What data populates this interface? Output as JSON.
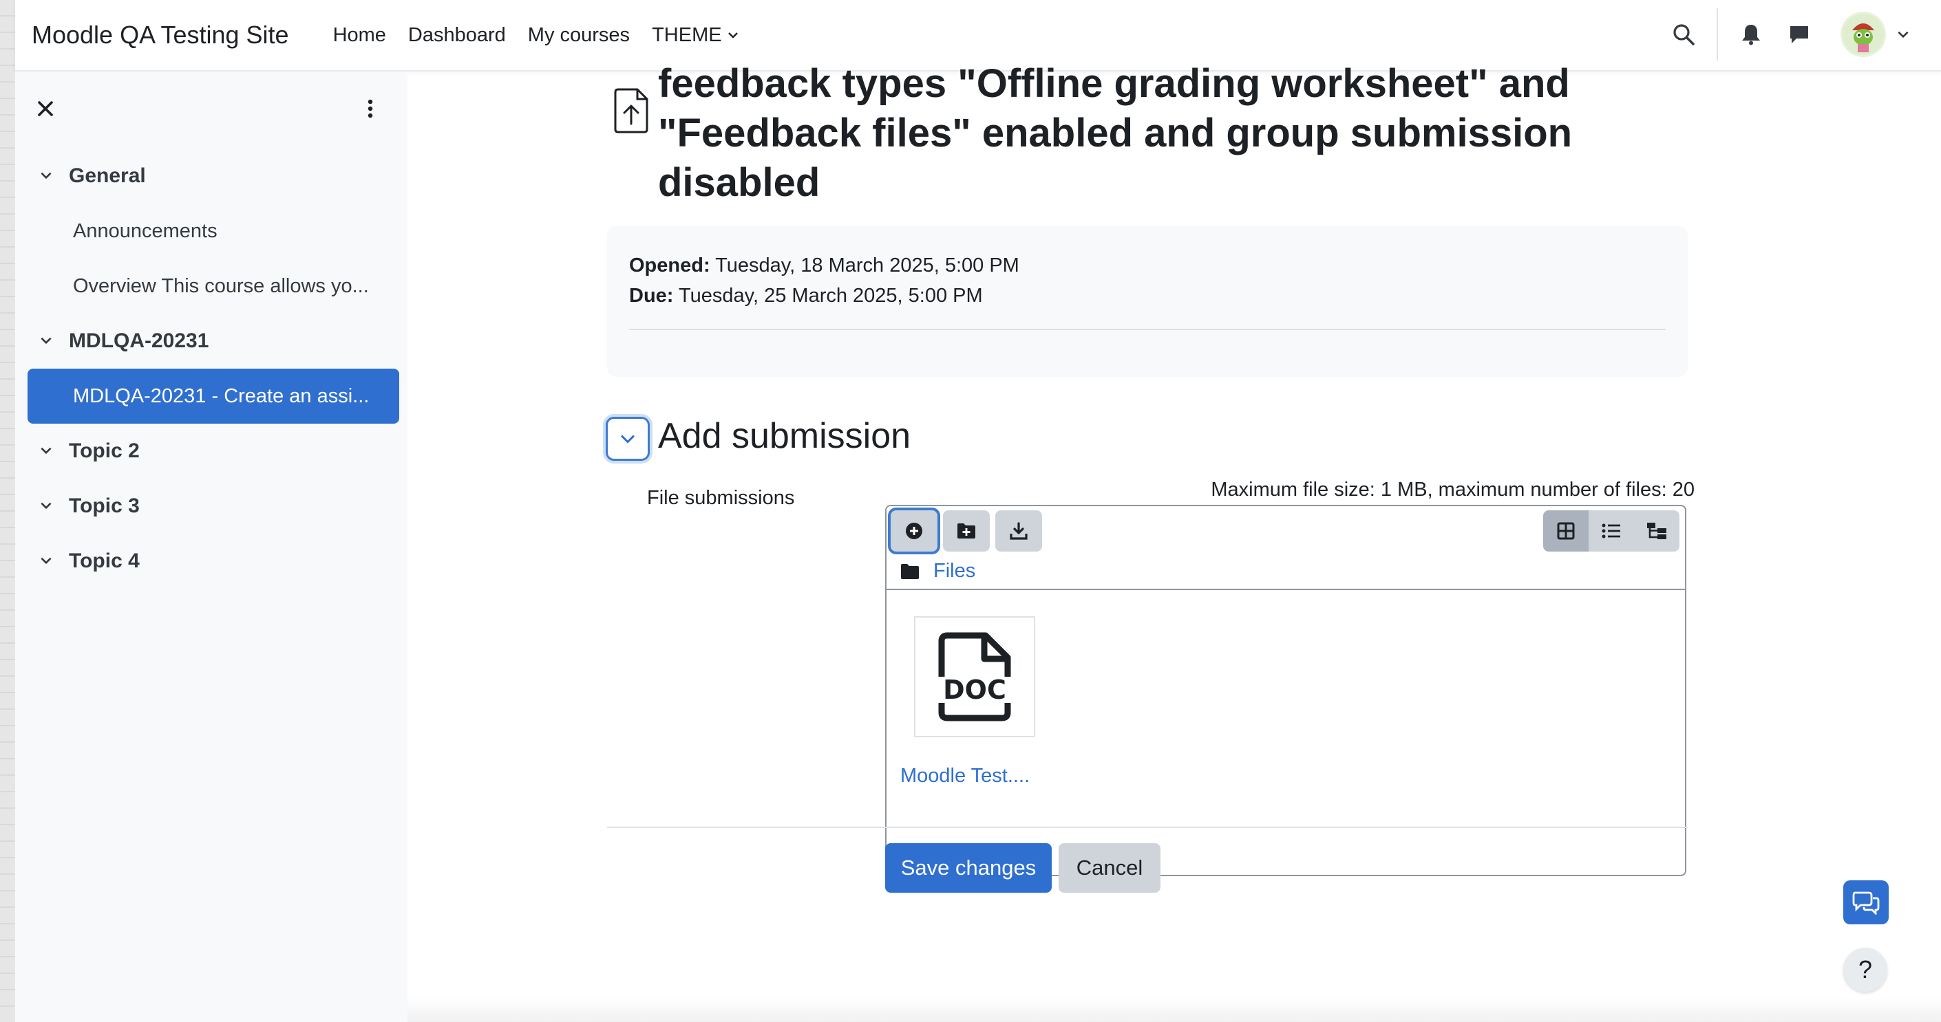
{
  "navbar": {
    "site_name": "Moodle QA Testing Site",
    "links": [
      "Home",
      "Dashboard",
      "My courses",
      "THEME"
    ]
  },
  "sidebar": {
    "sections": [
      {
        "label": "General",
        "items": [
          "Announcements",
          "Overview This course allows yo..."
        ]
      },
      {
        "label": "MDLQA-20231",
        "items": [
          "MDLQA-20231 - Create an assi..."
        ]
      },
      {
        "label": "Topic 2",
        "items": []
      },
      {
        "label": "Topic 3",
        "items": []
      },
      {
        "label": "Topic 4",
        "items": []
      }
    ],
    "active_item": "MDLQA-20231 - Create an assi..."
  },
  "main": {
    "title": "feedback types \"Offline grading worksheet\" and \"Feedback files\" enabled and group submission disabled",
    "dates": {
      "opened_label": "Opened:",
      "opened_value": " Tuesday, 18 March 2025, 5:00 PM",
      "due_label": "Due:",
      "due_value": " Tuesday, 25 March 2025, 5:00 PM"
    },
    "section_title": "Add submission",
    "file_submissions_label": "File submissions",
    "max_size": "Maximum file size: 1 MB, maximum number of files: 20",
    "files_path": "Files",
    "file": {
      "type_label": "DOC",
      "name": "Moodle Test...."
    },
    "save_label": "Save changes",
    "cancel_label": "Cancel",
    "help_label": "?"
  },
  "colors": {
    "primary": "#2f6fd0",
    "sidebar_bg": "#f8f9fa",
    "button_gray": "#ced4da"
  },
  "icons": [
    "search-icon",
    "bell-icon",
    "chat-icon",
    "close-icon",
    "kebab-icon",
    "chevron-down-icon",
    "upload-file-icon",
    "add-file-icon",
    "new-folder-icon",
    "download-icon",
    "grid-view-icon",
    "list-view-icon",
    "tree-view-icon",
    "folder-icon",
    "doc-file-icon"
  ]
}
